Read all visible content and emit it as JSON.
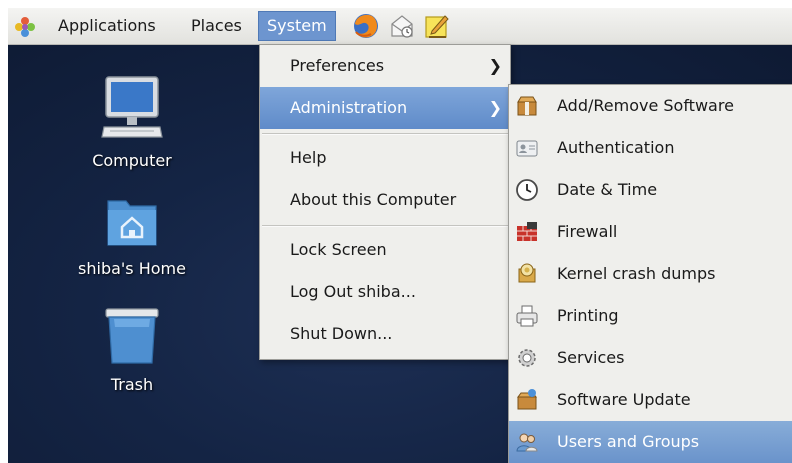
{
  "panel": {
    "menus": {
      "applications": "Applications",
      "places": "Places",
      "system": "System"
    },
    "launchers": [
      "firefox-icon",
      "mail-icon",
      "notes-icon"
    ]
  },
  "desktop": {
    "icons": {
      "computer": "Computer",
      "home": "shiba's Home",
      "trash": "Trash"
    }
  },
  "system_menu": {
    "preferences": "Preferences",
    "administration": "Administration",
    "help": "Help",
    "about": "About this Computer",
    "lock": "Lock Screen",
    "logout": "Log Out shiba...",
    "shutdown": "Shut Down..."
  },
  "admin_menu": {
    "items": [
      "Add/Remove Software",
      "Authentication",
      "Date & Time",
      "Firewall",
      "Kernel crash dumps",
      "Printing",
      "Services",
      "Software Update",
      "Users and Groups"
    ],
    "highlighted": "Users and Groups"
  },
  "colors": {
    "highlight": "#6a93cb",
    "desktop": "#142444",
    "menu_bg": "#efefec"
  }
}
